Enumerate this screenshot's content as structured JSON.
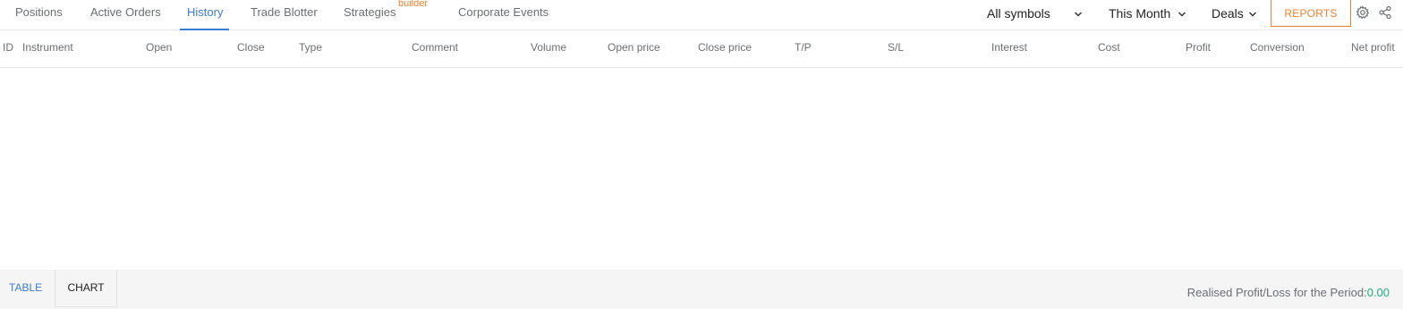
{
  "tabs": [
    {
      "label": "Positions"
    },
    {
      "label": "Active Orders"
    },
    {
      "label": "History"
    },
    {
      "label": "Trade Blotter"
    },
    {
      "label": "Strategies",
      "badge": "builder"
    },
    {
      "label": "Corporate Events"
    }
  ],
  "active_tab": "History",
  "filters": {
    "symbols": "All symbols",
    "period": "This Month",
    "kind": "Deals"
  },
  "reports_label": "REPORTS",
  "icons": {
    "settings": "gear-icon",
    "share": "share-icon",
    "dropdown": "chevron-down-icon"
  },
  "columns": [
    "ID",
    "Instrument",
    "Open",
    "Close",
    "Type",
    "Comment",
    "Volume",
    "Open price",
    "Close price",
    "T/P",
    "S/L",
    "Interest",
    "Cost",
    "Profit",
    "Conversion",
    "Net profit"
  ],
  "rows": [],
  "footer": {
    "view_tabs": {
      "table": "TABLE",
      "chart": "CHART"
    },
    "active_view": "TABLE",
    "pl_label": "Realised Profit/Loss for the Period:",
    "pl_value": "0.00"
  },
  "colors": {
    "accent": "#3a7bd5",
    "orange": "#f0802a",
    "positive": "#21b07a"
  }
}
